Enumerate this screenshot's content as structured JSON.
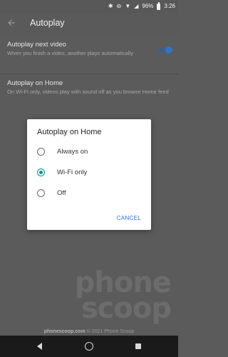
{
  "status_bar": {
    "battery_percent": "96%",
    "time": "3:26",
    "icons": [
      "bluetooth-icon",
      "do-not-disturb-icon",
      "wifi-icon",
      "signal-icon",
      "battery-icon"
    ]
  },
  "app_bar": {
    "back_icon": "back-arrow-icon",
    "title": "Autoplay"
  },
  "settings": [
    {
      "title": "Autoplay next video",
      "description": "When you finish a video, another plays automatically",
      "toggle_on": true
    },
    {
      "title": "Autoplay on Home",
      "description": "On Wi-Fi only, videos play with sound off as you browse Home feed"
    }
  ],
  "dialog": {
    "title": "Autoplay on Home",
    "options": [
      {
        "label": "Always on",
        "selected": false
      },
      {
        "label": "Wi-Fi only",
        "selected": true
      },
      {
        "label": "Off",
        "selected": false
      }
    ],
    "cancel_label": "CANCEL"
  },
  "watermark": {
    "line1": "phone",
    "line2": "scoop"
  },
  "footer": {
    "site": "phonescoop.com",
    "credit": "© 2021 Phone Scoop"
  },
  "colors": {
    "accent_teal": "#009688",
    "toggle_blue": "#2f74c9",
    "cancel_blue": "#2b6fd1"
  }
}
